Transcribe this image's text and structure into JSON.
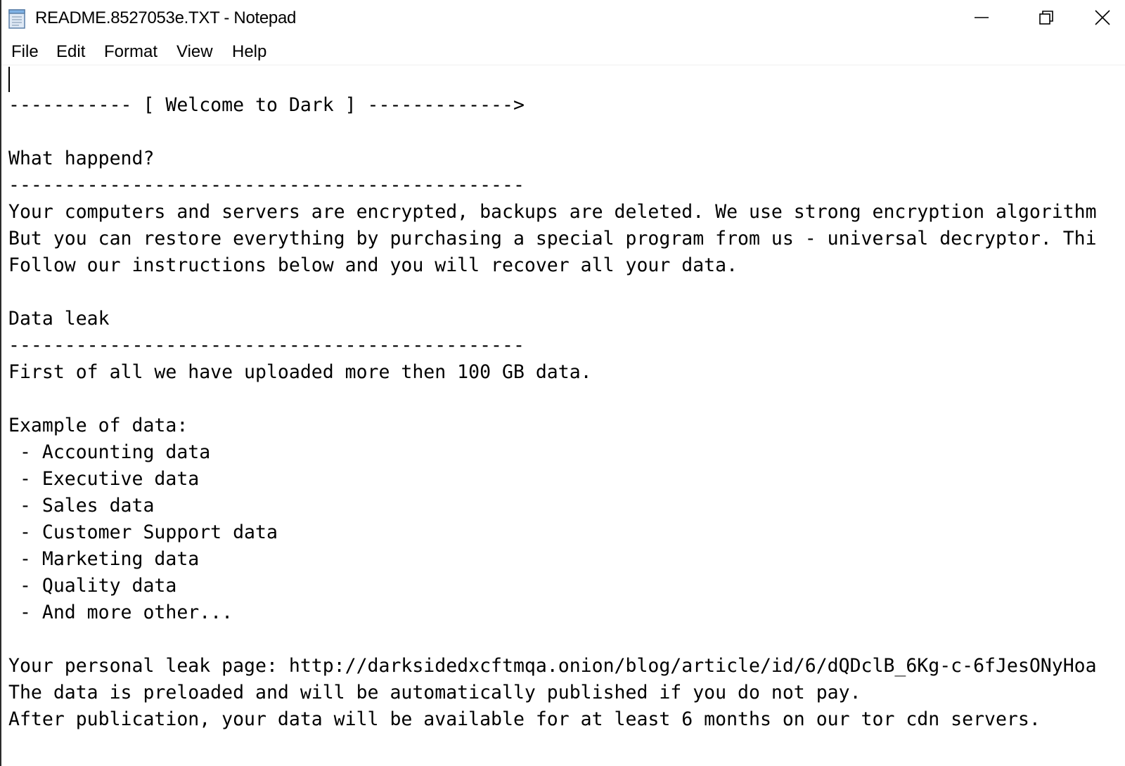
{
  "window": {
    "title": "README.8527053e.TXT - Notepad",
    "icon": "notepad-icon",
    "controls": [
      "minimize-icon",
      "restore-icon",
      "close-icon"
    ]
  },
  "menu": {
    "items": [
      "File",
      "Edit",
      "Format",
      "View",
      "Help"
    ]
  },
  "document": {
    "lines": [
      "",
      "----------- [ Welcome to Dark ] ------------->",
      "",
      "What happend?",
      "----------------------------------------------",
      "Your computers and servers are encrypted, backups are deleted. We use strong encryption algorithm",
      "But you can restore everything by purchasing a special program from us - universal decryptor. Thi",
      "Follow our instructions below and you will recover all your data.",
      "",
      "Data leak",
      "----------------------------------------------",
      "First of all we have uploaded more then 100 GB data.",
      "",
      "Example of data:",
      " - Accounting data",
      " - Executive data",
      " - Sales data",
      " - Customer Support data",
      " - Marketing data",
      " - Quality data",
      " - And more other...",
      "",
      "Your personal leak page: http://darksidedxcftmqa.onion/blog/article/id/6/dQDclB_6Kg-c-6fJesONyHoa",
      "The data is preloaded and will be automatically published if you do not pay.",
      "After publication, your data will be available for at least 6 months on our tor cdn servers."
    ]
  }
}
